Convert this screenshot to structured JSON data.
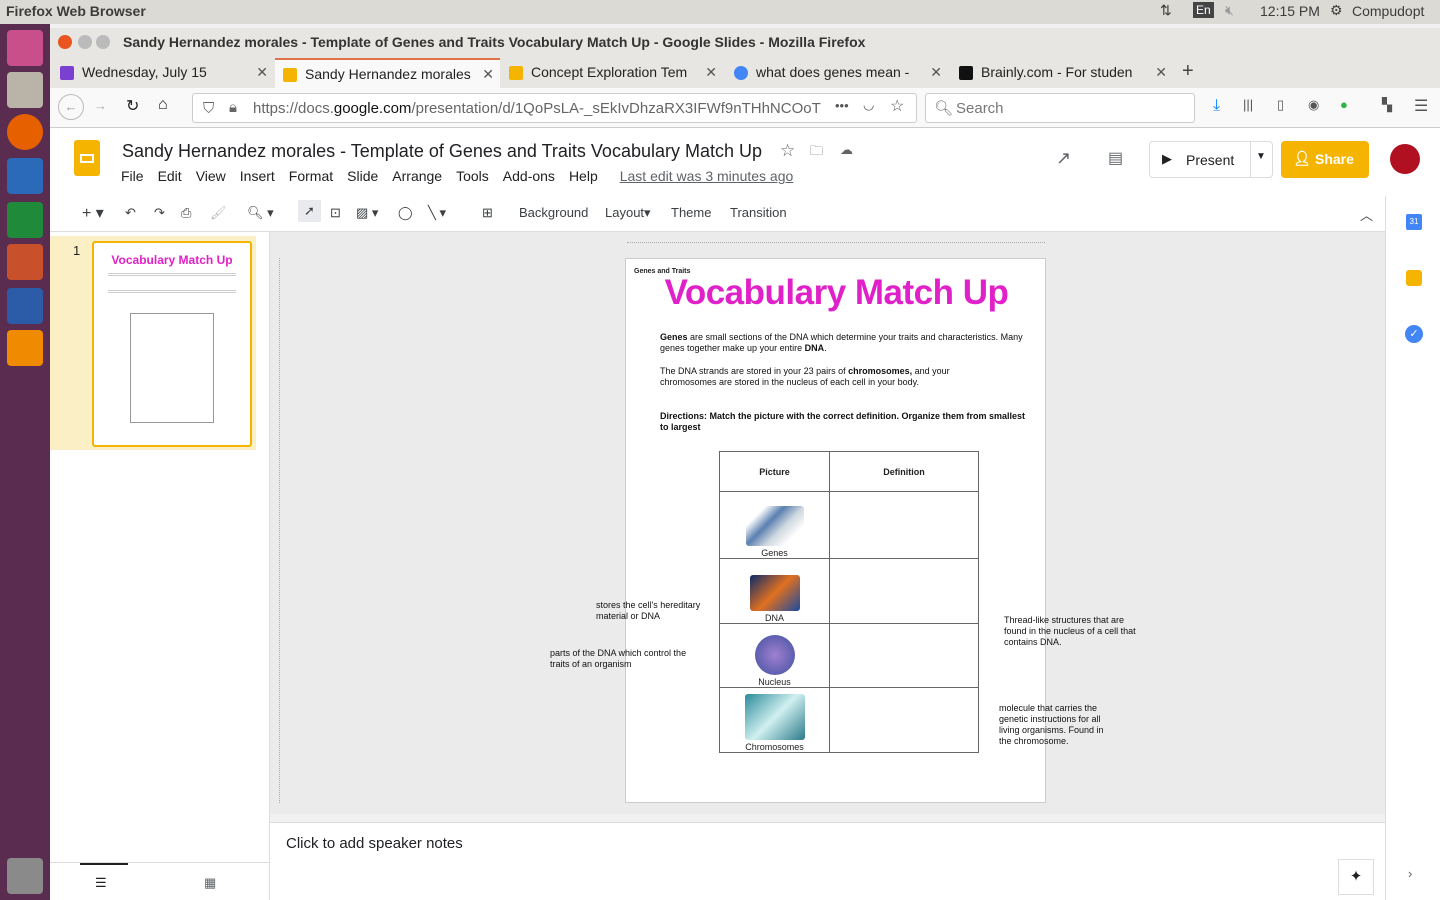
{
  "system": {
    "app_name": "Firefox Web Browser",
    "lang": "En",
    "time": "12:15 PM",
    "user": "Compudopt"
  },
  "window": {
    "title": "Sandy Hernandez morales - Template of Genes and Traits Vocabulary Match Up - Google Slides - Mozilla Firefox"
  },
  "tabs": [
    {
      "label": "Wednesday, July 15",
      "color": "#7b3fd1"
    },
    {
      "label": "Sandy Hernandez morales",
      "color": "#f4b400"
    },
    {
      "label": "Concept Exploration Tem",
      "color": "#f4b400"
    },
    {
      "label": "what does genes mean -",
      "color": "#4285f4"
    },
    {
      "label": "Brainly.com - For studen",
      "color": "#111111"
    }
  ],
  "nav": {
    "url_prefix": "https://docs.",
    "url_domain": "google.com",
    "url_rest": "/presentation/d/1QoPsLA-_sEkIvDhzaRX3IFWf9nTHhNCOoT",
    "search_placeholder": "Search"
  },
  "doc": {
    "title": "Sandy Hernandez morales - Template of Genes and Traits Vocabulary Match Up",
    "menus": [
      "File",
      "Edit",
      "View",
      "Insert",
      "Format",
      "Slide",
      "Arrange",
      "Tools",
      "Add-ons",
      "Help"
    ],
    "last_edit": "Last edit was 3 minutes ago",
    "present": "Present",
    "share": "Share"
  },
  "toolbar": {
    "background": "Background",
    "layout": "Layout",
    "theme": "Theme",
    "transition": "Transition"
  },
  "filmstrip": {
    "slide_number": "1"
  },
  "slide": {
    "kicker": "Genes and Traits",
    "title": "Vocabulary Match Up",
    "title_color": "#e020c8",
    "p1_bold": "Genes",
    "p1_text": " are small sections of the DNA which determine your traits and characteristics. Many genes together make up your entire ",
    "p1_bold2": "DNA",
    "p1_end": ".",
    "p2_text": "The DNA strands are stored in your 23 pairs of ",
    "p2_bold": "chromosomes,",
    "p2_end": " and your chromosomes are stored in the nucleus of each cell in your body.",
    "directions": "Directions: Match the picture with the correct definition.  Organize them from smallest to largest",
    "table_headers": [
      "Picture",
      "Definition"
    ],
    "rows": [
      {
        "label": "Genes"
      },
      {
        "label": "DNA"
      },
      {
        "label": "Nucleus"
      },
      {
        "label": "Chromosomes"
      }
    ]
  },
  "definitions": [
    "stores the cell's hereditary material or DNA",
    "parts of the DNA which control the traits of an organism",
    "Thread-like structures that are found in the nucleus of a cell that contains DNA.",
    "molecule that carries the genetic instructions for all living organisms. Found in the chromosome."
  ],
  "notes": {
    "placeholder": "Click to add speaker notes"
  }
}
